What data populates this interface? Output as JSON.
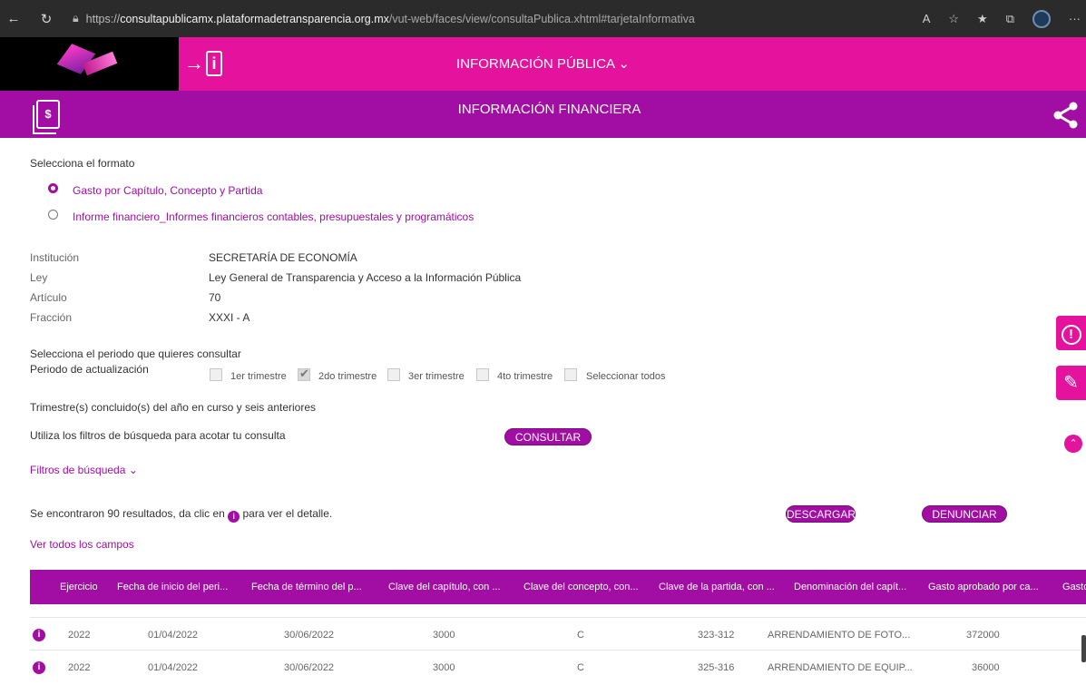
{
  "browser": {
    "url_protocol": "https://",
    "url_host": "consultapublicamx.plataformadetransparencia.org.mx",
    "url_path": "/vut-web/faces/view/consultaPublica.xhtml#tarjetaInformativa",
    "more_label": "···"
  },
  "header": {
    "info_publica": "INFORMACIÓN PÚBLICA ⌄",
    "login_symbol": "i"
  },
  "subheader": {
    "title": "INFORMACIÓN FINANCIERA",
    "doc_symbol": "$"
  },
  "formato": {
    "label": "Selecciona el formato",
    "options": [
      {
        "label": "Gasto por Capítulo, Concepto y Partida",
        "selected": true
      },
      {
        "label": "Informe financiero_Informes financieros contables, presupuestales y programáticos",
        "selected": false
      }
    ]
  },
  "fields": [
    {
      "label": "Institución",
      "value": "SECRETARÍA DE ECONOMÍA"
    },
    {
      "label": "Ley",
      "value": "Ley General de Transparencia y Acceso a la Información Pública"
    },
    {
      "label": "Artículo",
      "value": "70"
    },
    {
      "label": "Fracción",
      "value": "XXXI - A"
    }
  ],
  "periodo": {
    "title": "Selecciona el periodo que quieres consultar",
    "label": "Periodo de actualización",
    "options": [
      {
        "label": "1er trimestre",
        "checked": false
      },
      {
        "label": "2do trimestre",
        "checked": true
      },
      {
        "label": "3er trimestre",
        "checked": false
      },
      {
        "label": "4to trimestre",
        "checked": false
      },
      {
        "label": "Seleccionar todos",
        "checked": false
      }
    ],
    "note": "Trimestre(s) concluido(s) del año en curso y seis anteriores"
  },
  "filtros": {
    "hint": "Utiliza los filtros de búsqueda para acotar tu consulta",
    "consultar_label": "CONSULTAR",
    "toggle_label": "Filtros de búsqueda ⌄"
  },
  "results": {
    "text_before": "Se encontraron 90 resultados, da clic en",
    "text_after": "para ver el detalle.",
    "descargar_label": "DESCARGAR",
    "denunciar_label": "DENUNCIAR",
    "ver_todos": "Ver todos los campos"
  },
  "table": {
    "columns": [
      "Ejercicio",
      "Fecha de inicio del peri...",
      "Fecha de término del p...",
      "Clave del capítulo, con ...",
      "Clave del concepto, con...",
      "Clave de la partida, con ...",
      "Denominación del capít...",
      "Gasto aprobado por ca...",
      "Gasto"
    ],
    "rows": [
      [
        "2022",
        "01/04/2022",
        "30/06/2022",
        "3000",
        "C",
        "323-312",
        "ARRENDAMIENTO DE FOTO...",
        "372000"
      ],
      [
        "2022",
        "01/04/2022",
        "30/06/2022",
        "3000",
        "C",
        "325-316",
        "ARRENDAMIENTO DE EQUIP...",
        "36000"
      ]
    ]
  },
  "side": {
    "alert_symbol": "!",
    "tool_symbol": "✎",
    "up_symbol": "⌃"
  }
}
